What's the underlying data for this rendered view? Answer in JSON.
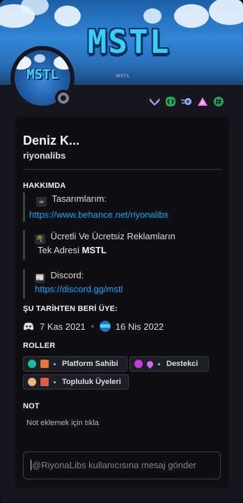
{
  "banner": {
    "logo": "MSTL",
    "sub": "MSTL"
  },
  "avatar": {
    "logo": "MSTL",
    "status": "offline"
  },
  "badges": [
    {
      "icon": "nitro-chevron-icon",
      "color": "#b794f6"
    },
    {
      "icon": "active-developer-icon",
      "color": "#23a55a"
    },
    {
      "icon": "boost-orbs-icon",
      "color": "#9fb3ff"
    },
    {
      "icon": "hypesquad-triangle-icon",
      "color": "#f47fff"
    },
    {
      "icon": "hashtag-badge-icon",
      "color": "#23a55a"
    }
  ],
  "profile": {
    "display_name": "Deniz K...",
    "username": "riyonalibs"
  },
  "about": {
    "title": "HAKKIMDA",
    "block1": {
      "emoji": "coffee-icon",
      "label": "Tasarımlarım:",
      "link": "https://www.behance.net/riyonalibs"
    },
    "block2": {
      "emoji": "palm-tree-icon",
      "line1": "Ücretli Ve Ücretsiz Reklamların",
      "line2_prefix": "Tek Adresi",
      "line2_bold": "MSTL"
    },
    "block3": {
      "emoji": "newspaper-icon",
      "label": "Discord:",
      "link": "https://discord.gg/mstl"
    }
  },
  "member_since": {
    "title": "ŞU TARİHTEN BERİ ÜYE:",
    "discord_date": "7 Kas 2021",
    "server_date": "16 Nis 2022"
  },
  "roles": {
    "title": "ROLLER",
    "items": [
      {
        "name": "Platform Sahibi",
        "color": "#1abc9c"
      },
      {
        "name": "Destekci",
        "color": "#c43ad8"
      },
      {
        "name": "Topluluk Üyeleri",
        "color": "#f0b27a"
      }
    ]
  },
  "note": {
    "title": "NOT",
    "placeholder": "Not eklemek için tıkla"
  },
  "message": {
    "placeholder": "@RiyonaLibs kullanıcısına mesaj gönder"
  }
}
